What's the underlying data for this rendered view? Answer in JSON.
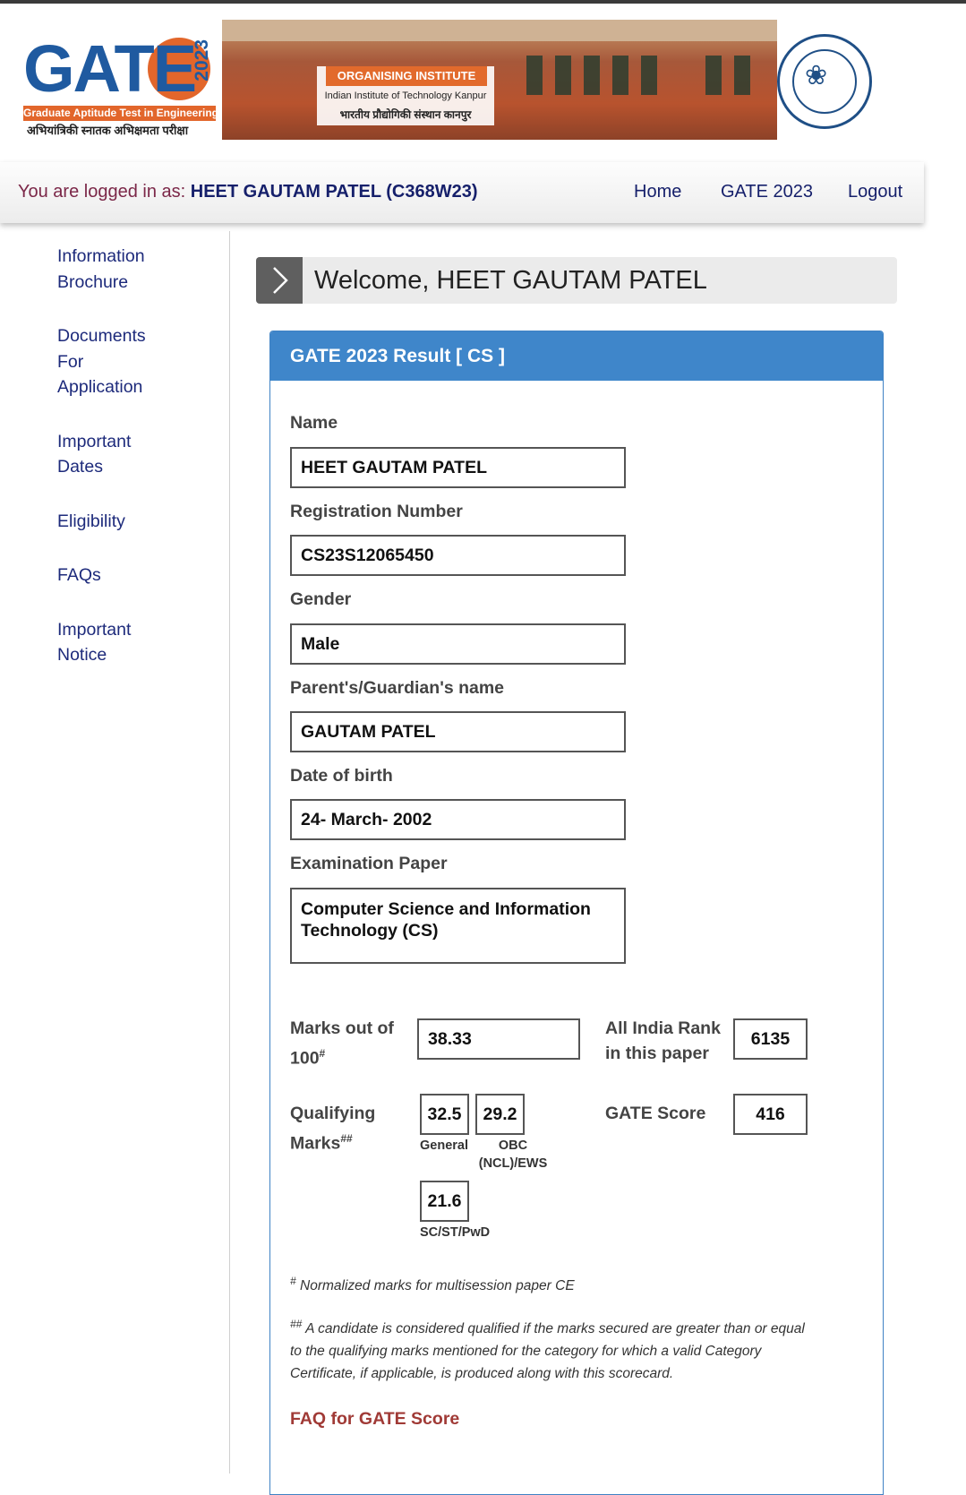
{
  "header": {
    "logo": {
      "word": "GATE",
      "year": "2023",
      "tagline": "Graduate Aptitude Test in Engineering",
      "hindi": "अभियांत्रिकी स्नातक अभिक्षमता परीक्षा"
    },
    "organising": {
      "title": "ORGANISING INSTITUTE",
      "name_en": "Indian Institute of Technology Kanpur",
      "name_hi": "भारतीय प्रौद्योगिकी संस्थान कानपुर"
    }
  },
  "nav": {
    "logged_prefix": "You are logged in as:",
    "logged_user": "HEET GAUTAM PATEL (C368W23)",
    "links": [
      "Home",
      "GATE 2023",
      "Logout"
    ]
  },
  "sidebar": {
    "items": [
      {
        "label": "Information Brochure"
      },
      {
        "label": "Documents For Application"
      },
      {
        "label": "Important Dates"
      },
      {
        "label": "Eligibility"
      },
      {
        "label": "FAQs"
      },
      {
        "label": "Important Notice"
      }
    ]
  },
  "welcome": "Welcome, HEET GAUTAM PATEL",
  "result": {
    "title": "GATE 2023 Result [ CS ]",
    "fields": [
      {
        "label": "Name",
        "value": "HEET GAUTAM PATEL"
      },
      {
        "label": "Registration Number",
        "value": "CS23S12065450"
      },
      {
        "label": "Gender",
        "value": "Male"
      },
      {
        "label": "Parent's/Guardian's name",
        "value": "GAUTAM PATEL"
      },
      {
        "label": "Date of birth",
        "value": "24- March- 2002"
      },
      {
        "label": "Examination Paper",
        "value": "Computer Science and Information Technology (CS)"
      }
    ],
    "marks": {
      "label": "Marks out of 100",
      "sup": "#",
      "value": "38.33"
    },
    "rank": {
      "label": "All India Rank in this paper",
      "value": "6135"
    },
    "qualifying": {
      "label": "Qualifying Marks",
      "sup": "##",
      "general": {
        "value": "32.5",
        "caption": "General"
      },
      "obc": {
        "value": "29.2",
        "caption": "OBC (NCL)/EWS"
      },
      "sc": {
        "value": "21.6",
        "caption": "SC/ST/PwD"
      }
    },
    "score": {
      "label": "GATE Score",
      "value": "416"
    },
    "note1": {
      "mark": "#",
      "text": "Normalized marks for multisession paper CE"
    },
    "note2": {
      "mark": "##",
      "text": "A candidate is considered qualified if the marks secured are greater than or equal to the qualifying marks mentioned for the category for which a valid Category Certificate, if applicable, is produced along with this scorecard."
    },
    "faq_link": "FAQ for GATE Score"
  }
}
